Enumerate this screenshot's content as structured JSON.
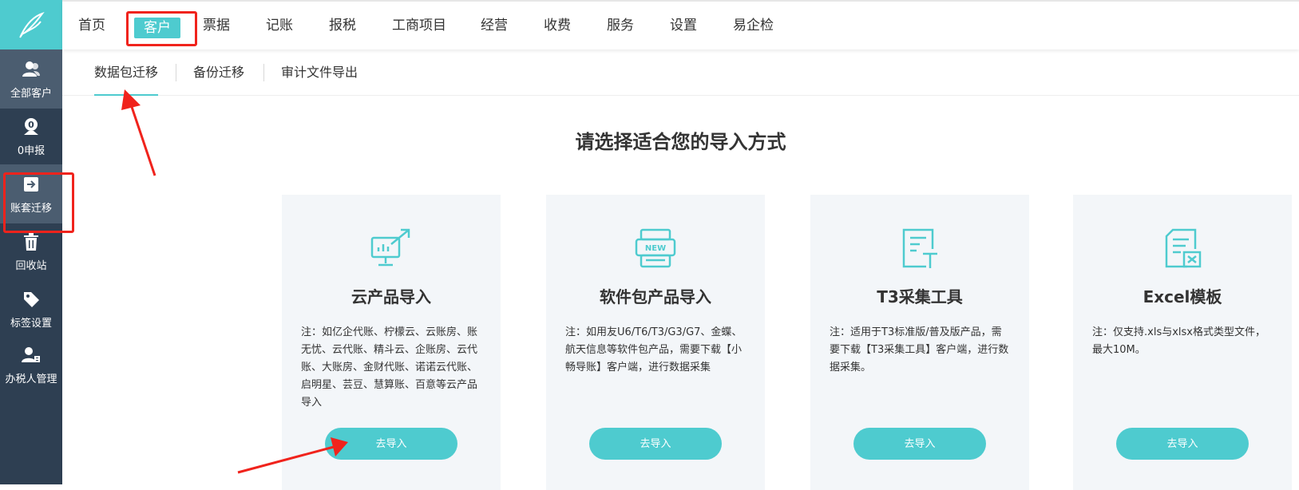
{
  "top_nav": [
    "首页",
    "客户",
    "票据",
    "记账",
    "报税",
    "工商项目",
    "经营",
    "收费",
    "服务",
    "设置",
    "易企检"
  ],
  "sidebar": [
    {
      "label": "全部客户",
      "icon": "users-icon"
    },
    {
      "label": "0申报",
      "icon": "zero-declaration-icon"
    },
    {
      "label": "账套迁移",
      "icon": "migrate-icon"
    },
    {
      "label": "回收站",
      "icon": "trash-icon"
    },
    {
      "label": "标签设置",
      "icon": "tag-icon"
    },
    {
      "label": "办税人管理",
      "icon": "tax-agent-icon"
    }
  ],
  "sub_tabs": [
    "数据包迁移",
    "备份迁移",
    "审计文件导出"
  ],
  "heading": "请选择适合您的导入方式",
  "cards": [
    {
      "title": "云产品导入",
      "icon": "cloud-import-icon",
      "desc": "注：如亿企代账、柠檬云、云账房、账无忧、云代账、精斗云、企账房、云代账、大账房、金财代账、诺诺云代账、启明星、芸豆、慧算账、百意等云产品导入",
      "button": "去导入"
    },
    {
      "title": "软件包产品导入",
      "icon": "software-package-icon",
      "desc": "注：如用友U6/T6/T3/G3/G7、金蝶、航天信息等软件包产品，需要下载【小畅导账】客户端，进行数据采集",
      "button": "去导入"
    },
    {
      "title": "T3采集工具",
      "icon": "t3-tool-icon",
      "desc": "注：适用于T3标准版/普及版产品，需要下载【T3采集工具】客户端，进行数据采集。",
      "button": "去导入"
    },
    {
      "title": "Excel模板",
      "icon": "excel-template-icon",
      "desc": "注：仅支持.xls与xlsx格式类型文件，最大10M。",
      "button": "去导入"
    }
  ],
  "icon_text": {
    "new_badge": "NEW",
    "zero_badge": "0"
  },
  "colors": {
    "accent": "#4ecbcf",
    "sidebar": "#2e3f52",
    "annotation": "#f0231c"
  }
}
